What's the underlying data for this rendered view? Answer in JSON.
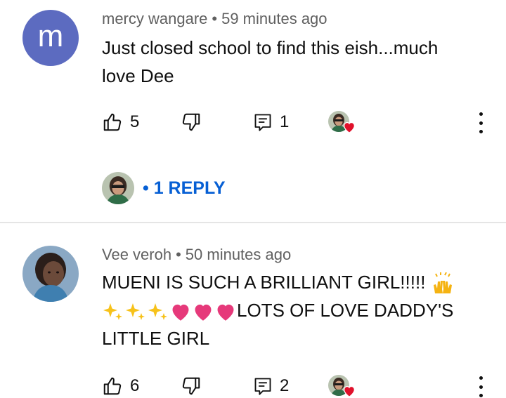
{
  "comments": [
    {
      "avatar_letter": "m",
      "author": "mercy wangare",
      "separator": "•",
      "time": "59 minutes ago",
      "text": "Just closed school to find this eish...much love Dee",
      "likes": "5",
      "replies_count": "1",
      "reply_link": "• 1 REPLY",
      "avatar_color": "#5c6bc0"
    },
    {
      "author": "Vee veroh",
      "separator": "•",
      "time": "50 minutes ago",
      "line1": "MUENI IS SUCH  A BRILLIANT GIRL!!!!!",
      "line2": "LOTS OF LOVE DADDY'S",
      "line3": "LITTLE GIRL",
      "likes": "6",
      "replies_count": "2"
    }
  ],
  "colors": {
    "link": "#065fd4",
    "meta": "#606060",
    "heart": "#e0112b",
    "divider": "#e5e5e5"
  }
}
